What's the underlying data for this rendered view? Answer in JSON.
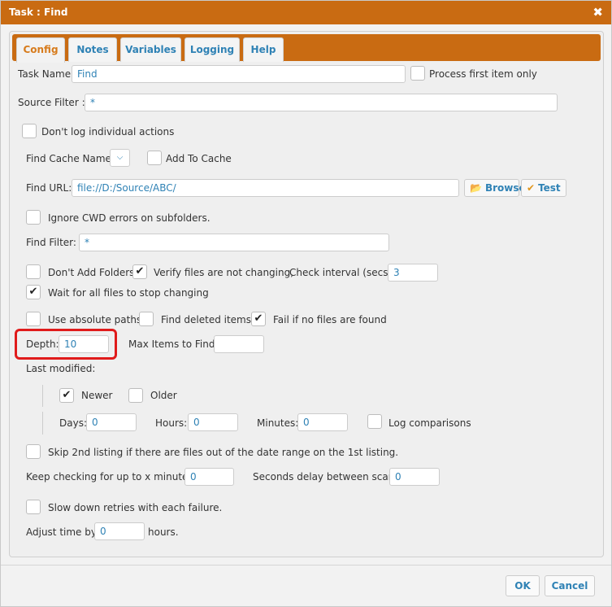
{
  "window": {
    "title": "Task : Find",
    "close_glyph": "✖"
  },
  "tabs": [
    {
      "label": "Config",
      "active": true
    },
    {
      "label": "Notes"
    },
    {
      "label": "Variables"
    },
    {
      "label": "Logging"
    },
    {
      "label": "Help"
    }
  ],
  "task_name": {
    "label": "Task Name:",
    "value": "Find"
  },
  "process_first": {
    "label": "Process first item only",
    "checked": false
  },
  "source_filter": {
    "label": "Source Filter :",
    "value": "*"
  },
  "dont_log": {
    "label": "Don't log individual actions",
    "checked": false
  },
  "find_cache": {
    "label": "Find Cache Name:",
    "value": ""
  },
  "add_to_cache": {
    "label": "Add To Cache",
    "checked": false
  },
  "find_url": {
    "label": "Find URL:",
    "value": "file://D:/Source/ABC/"
  },
  "browse": {
    "label": "Browse",
    "icon": "folder-open-icon"
  },
  "test": {
    "label": "Test",
    "icon": "check-circle-icon"
  },
  "ignore_cwd": {
    "label": "Ignore CWD errors on subfolders.",
    "checked": false
  },
  "find_filter": {
    "label": "Find Filter:",
    "value": "*"
  },
  "dont_add_folders": {
    "label": "Don't Add Folders",
    "checked": false
  },
  "verify_files": {
    "label": "Verify files are not changing,",
    "checked": true
  },
  "check_interval": {
    "label": "Check interval (secs):",
    "value": "3"
  },
  "wait_all": {
    "label": "Wait for all files to stop changing",
    "checked": true
  },
  "use_absolute": {
    "label": "Use absolute paths",
    "checked": false
  },
  "find_deleted": {
    "label": "Find deleted items",
    "checked": false
  },
  "fail_if_none": {
    "label": "Fail if no files are found",
    "checked": true
  },
  "depth": {
    "label": "Depth:",
    "value": "10"
  },
  "max_items": {
    "label": "Max Items to Find:",
    "value": ""
  },
  "last_modified": {
    "label": "Last modified:",
    "newer": {
      "label": "Newer",
      "checked": true
    },
    "older": {
      "label": "Older",
      "checked": false
    },
    "days": {
      "label": "Days:",
      "value": "0"
    },
    "hours": {
      "label": "Hours:",
      "value": "0"
    },
    "minutes": {
      "label": "Minutes:",
      "value": "0"
    },
    "log_comparisons": {
      "label": "Log comparisons",
      "checked": false
    }
  },
  "skip_2nd": {
    "label": "Skip 2nd listing if there are files out of the date range on the 1st listing.",
    "checked": false
  },
  "keep_checking": {
    "label": "Keep checking for up to x minutes:",
    "value": "0"
  },
  "seconds_delay": {
    "label": "Seconds delay between scans:",
    "value": "0"
  },
  "slow_down": {
    "label": "Slow down retries with each failure.",
    "checked": false
  },
  "adjust_time": {
    "label": "Adjust time by",
    "value": "0",
    "suffix": "hours."
  },
  "footer": {
    "ok": "OK",
    "cancel": "Cancel"
  },
  "colors": {
    "accent": "#c96b12",
    "link": "#2f82b5",
    "highlight": "#e01b1b"
  }
}
